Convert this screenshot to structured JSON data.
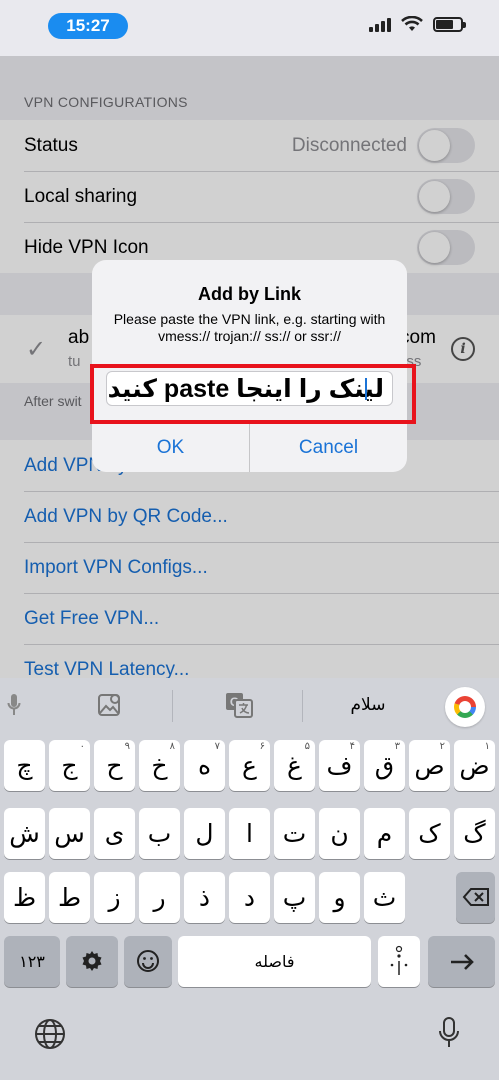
{
  "status_bar": {
    "time": "15:27"
  },
  "settings": {
    "section_header": "VPN CONFIGURATIONS",
    "rows": [
      {
        "label": "Status",
        "value": "Disconnected"
      },
      {
        "label": "Local sharing"
      },
      {
        "label": "Hide VPN Icon"
      }
    ],
    "vpn_item": {
      "name_start": "ab",
      "name_end": "com",
      "sub_start": "tu",
      "sub_end": "ess"
    },
    "footer_note": "After swit",
    "actions": [
      "Add VPN by",
      "Add VPN by QR Code...",
      "Import VPN Configs...",
      "Get Free VPN...",
      "Test VPN Latency..."
    ]
  },
  "alert": {
    "title": "Add by Link",
    "message": "Please paste the VPN link, e.g. starting with vmess:// trojan:// ss:// or ssr://",
    "input_value": "لینک را اینجا paste کنید",
    "ok_label": "OK",
    "cancel_label": "Cancel"
  },
  "keyboard": {
    "suggestion": "سلام",
    "row1": [
      {
        "k": "ض",
        "n": "۱"
      },
      {
        "k": "ص",
        "n": "۲"
      },
      {
        "k": "ق",
        "n": "۳"
      },
      {
        "k": "ف",
        "n": "۴"
      },
      {
        "k": "غ",
        "n": "۵"
      },
      {
        "k": "ع",
        "n": "۶"
      },
      {
        "k": "ه",
        "n": "۷"
      },
      {
        "k": "خ",
        "n": "۸"
      },
      {
        "k": "ح",
        "n": "۹"
      },
      {
        "k": "ج",
        "n": "۰"
      },
      {
        "k": "چ",
        "n": ""
      }
    ],
    "row2": [
      "ش",
      "س",
      "ی",
      "ب",
      "ل",
      "ا",
      "ت",
      "ن",
      "م",
      "ک",
      "گ"
    ],
    "row3": [
      "ظ",
      "ط",
      "ز",
      "ر",
      "ذ",
      "د",
      "پ",
      "و",
      "ث"
    ],
    "numbers_key": "۱۲۳",
    "space_label": "فاصله"
  }
}
